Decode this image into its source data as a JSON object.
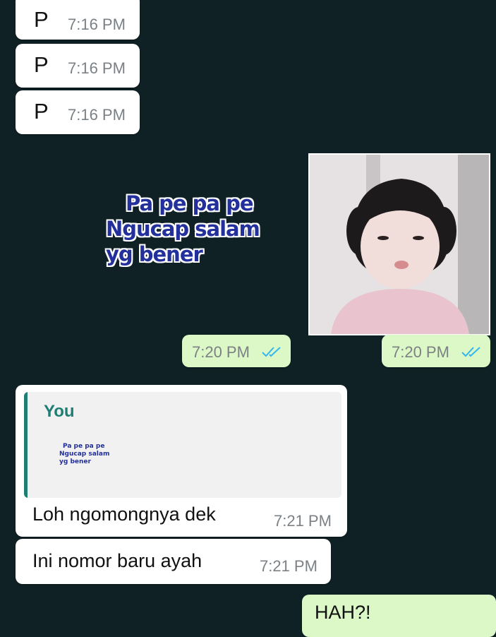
{
  "messages_in_top": [
    {
      "text": "P",
      "time": "7:16 PM"
    },
    {
      "text": "P",
      "time": "7:16 PM"
    },
    {
      "text": "P",
      "time": "7:16 PM"
    }
  ],
  "sticker_text": {
    "line1": "Pa pe pa pe",
    "line2": "Ngucap salam",
    "line3": "yg bener"
  },
  "sticker_time": "7:20 PM",
  "photo_time": "7:20 PM",
  "reply": {
    "quoted_sender": "You",
    "quoted_line1": "Pa pe pa pe",
    "quoted_line2": "Ngucap salam",
    "quoted_line3": "yg bener",
    "text": "Loh ngomongnya dek",
    "time": "7:21 PM"
  },
  "message_in_2": {
    "text": "Ini nomor baru ayah",
    "time": "7:21 PM"
  },
  "partial_out": {
    "text": "HAH?!"
  },
  "colors": {
    "background": "#0f2125",
    "incoming_bubble": "#ffffff",
    "outgoing_bubble": "#dcf8c6",
    "read_ticks": "#34b7f1",
    "quote_accent": "#1f7e73",
    "sticker_text": "#23309b"
  }
}
